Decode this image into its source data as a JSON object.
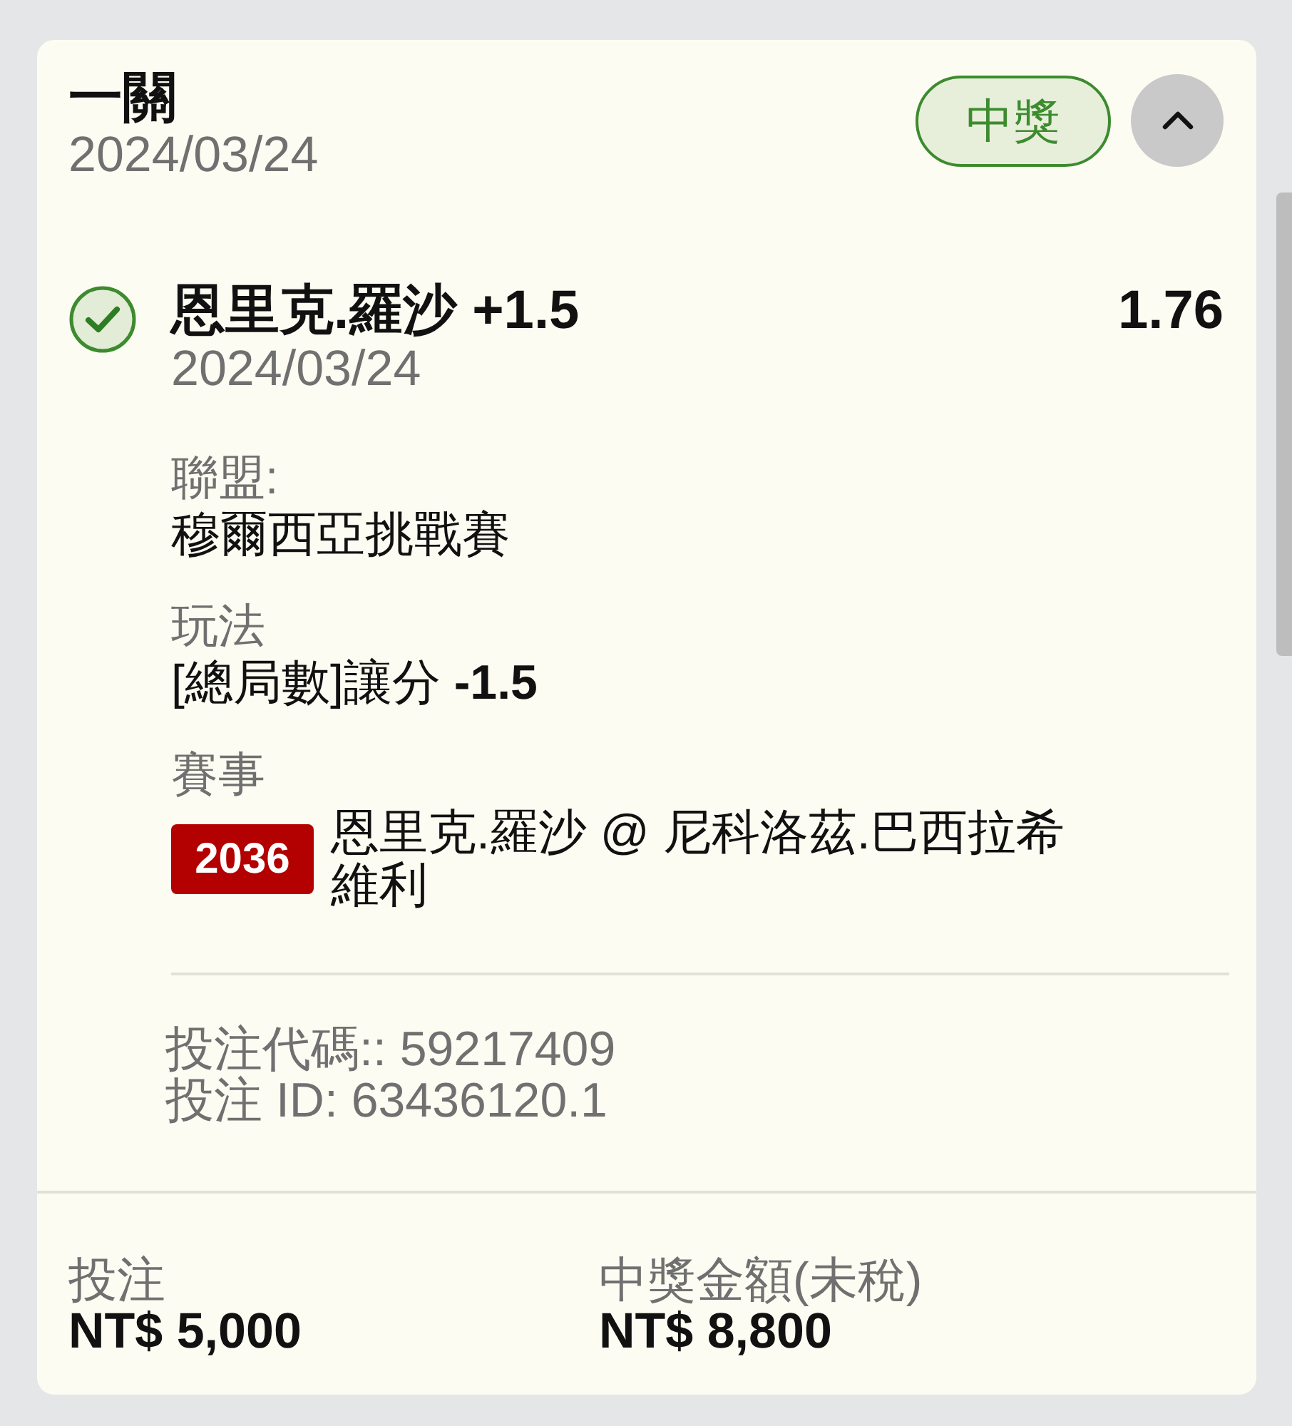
{
  "bet": {
    "title": "一關",
    "date": "2024/03/24",
    "status": {
      "label": "中獎",
      "won": true
    },
    "expanded": true
  },
  "selection": {
    "won": true,
    "title": "恩里克.羅沙 +1.5",
    "odds": "1.76",
    "date": "2024/03/24",
    "details": [
      {
        "label": "聯盟:",
        "value": "穆爾西亞挑戰賽"
      },
      {
        "label": "玩法",
        "value": "[總局數]讓分 **-1.5**"
      }
    ],
    "event": {
      "label": "賽事",
      "code": "2036",
      "name": "恩里克.羅沙 @ 尼科洛茲.巴西拉希維利"
    }
  },
  "refs": [
    "投注代碼:: 59217409",
    "投注 ID: 63436120.1"
  ],
  "totals": [
    {
      "label": "投注",
      "value": "NT$ 5,000"
    },
    {
      "label": "中獎金額(未稅)",
      "value": "NT$ 8,800"
    }
  ]
}
